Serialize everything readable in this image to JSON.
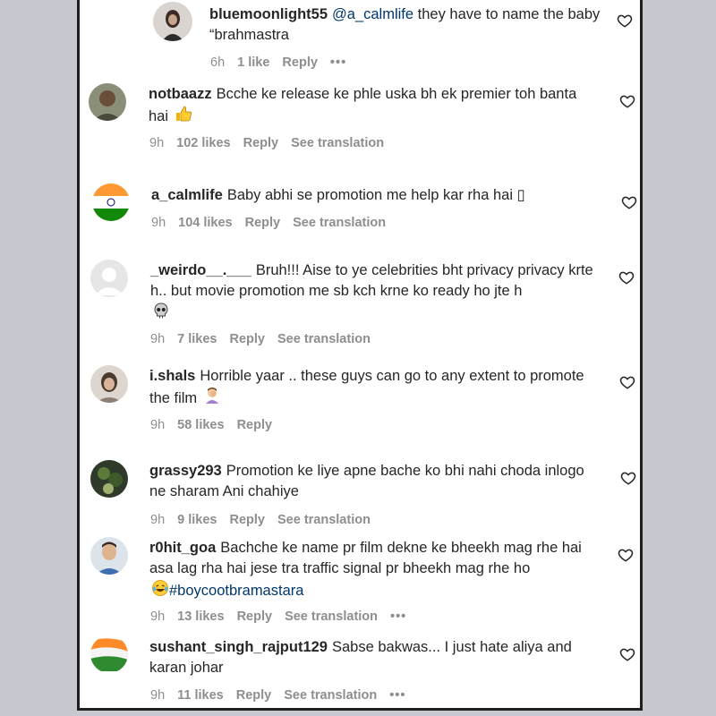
{
  "comments": [
    {
      "user": "bluemoonlight55",
      "mention": "@a_calmlife",
      "text": "they have to name the baby “brahmastra",
      "time": "6h",
      "likes": "1 like",
      "reply": "Reply",
      "more": "•••"
    },
    {
      "user": "notbaazz",
      "text": "Bcche ke release ke phle uska bh ek premier toh banta hai",
      "time": "9h",
      "likes": "102 likes",
      "reply": "Reply",
      "translate": "See translation"
    },
    {
      "user": "a_calmlife",
      "text": "Baby abhi se promotion me help kar rha hai ▯",
      "time": "9h",
      "likes": "104 likes",
      "reply": "Reply",
      "translate": "See translation"
    },
    {
      "user": "_weirdo__.___",
      "text": "Bruh!!! Aise to ye celebrities bht privacy privacy krte h.. but movie promotion me sb kch krne ko ready ho jte h",
      "time": "9h",
      "likes": "7 likes",
      "reply": "Reply",
      "translate": "See translation"
    },
    {
      "user": "i.shals",
      "text": "Horrible yaar .. these guys can go to any extent to promote the film",
      "time": "9h",
      "likes": "58 likes",
      "reply": "Reply"
    },
    {
      "user": "grassy293",
      "text": "Promotion ke liye apne bache ko bhi nahi choda inlogo ne sharam Ani chahiye",
      "time": "9h",
      "likes": "9 likes",
      "reply": "Reply",
      "translate": "See translation"
    },
    {
      "user": "r0hit_goa",
      "text": "Bachche ke name pr film dekne ke bheekh mag rhe hai asa lag rha hai jese tra traffic signal pr bheekh mag rhe ho",
      "hashtag": "#boycootbramastara",
      "time": "9h",
      "likes": "13 likes",
      "reply": "Reply",
      "translate": "See translation",
      "more": "•••"
    },
    {
      "user": "sushant_singh_rajput129",
      "text": "Sabse bakwas... I just hate aliya and karan johar",
      "time": "9h",
      "likes": "11 likes",
      "reply": "Reply",
      "translate": "See translation",
      "more": "•••"
    }
  ],
  "icons": {
    "like": "heart-outline-icon"
  },
  "colors": {
    "text": "#262626",
    "meta": "#8e8e8e",
    "link": "#00376b",
    "background": "#ffffff",
    "border": "#1f1f1f"
  }
}
